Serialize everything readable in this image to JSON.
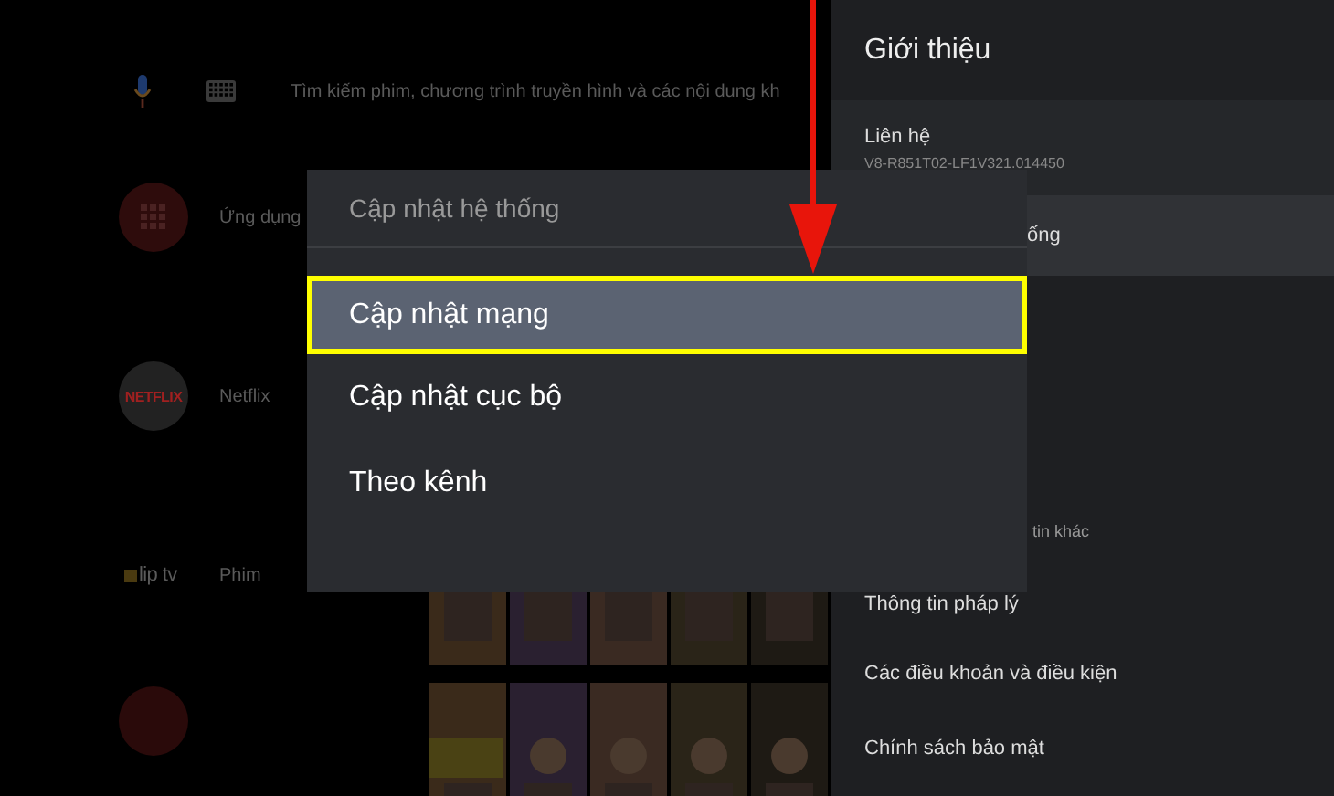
{
  "search": {
    "placeholder": "Tìm kiếm phim, chương trình truyền hình và các nội dung kh"
  },
  "home_rows": [
    {
      "kind": "apps",
      "label": "Ứng dụng"
    },
    {
      "kind": "netflix",
      "logo": "NETFLIX",
      "label": "Netflix"
    },
    {
      "kind": "cliptv",
      "logo": "lip tv",
      "label": "Phim"
    },
    {
      "kind": "red_circle"
    }
  ],
  "panel": {
    "title": "Giới thiệu",
    "items": [
      {
        "kind": "row",
        "label": "Liên hệ",
        "subtitle": "V8-R851T02-LF1V321.014450",
        "selected": false
      },
      {
        "kind": "covered",
        "label": "ống",
        "selected": true
      },
      {
        "kind": "covered_note",
        "subtitle": "tin khác",
        "selected": false
      },
      {
        "kind": "row",
        "label": "Thông tin pháp lý",
        "selected": false
      },
      {
        "kind": "row",
        "label": "Các điều khoản và điều kiện",
        "selected": false
      },
      {
        "kind": "row",
        "label": "Chính sách bảo mật",
        "selected": false
      }
    ]
  },
  "dialog": {
    "title": "Cập nhật hệ thống",
    "options": [
      {
        "label": "Cập nhật mạng",
        "selected": true
      },
      {
        "label": "Cập nhật cục bộ",
        "selected": false
      },
      {
        "label": "Theo kênh",
        "selected": false
      }
    ]
  }
}
